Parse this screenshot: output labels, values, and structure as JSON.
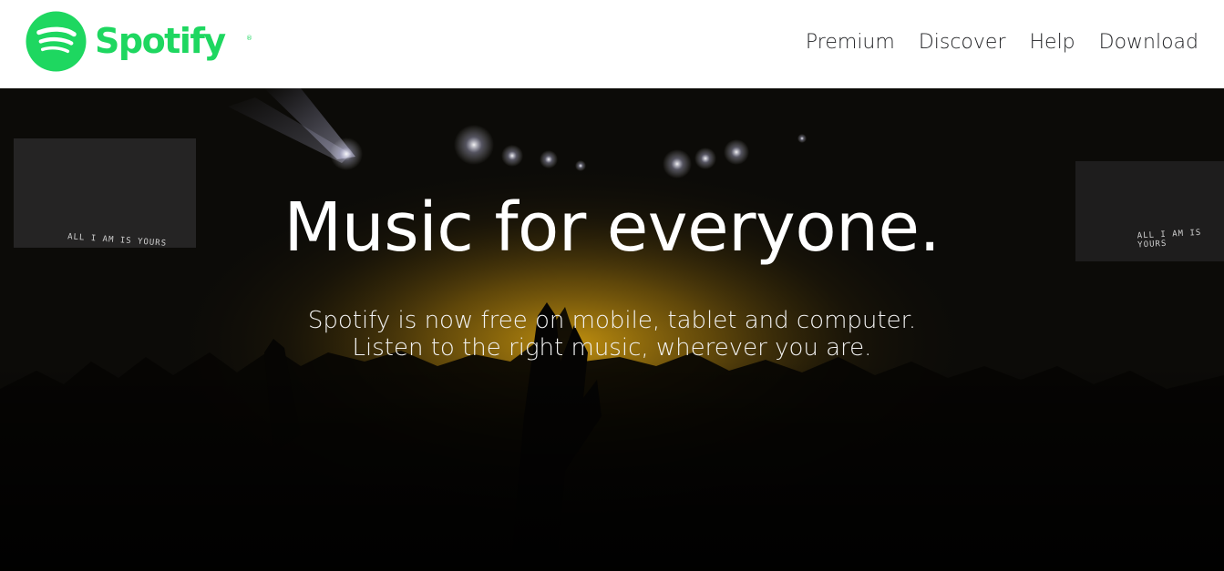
{
  "brand": {
    "name": "Spotify",
    "registered_mark": "®",
    "color": "#1ed760",
    "icon": "spotify-logo-icon"
  },
  "nav": {
    "links": [
      {
        "label": "Premium"
      },
      {
        "label": "Discover"
      },
      {
        "label": "Help"
      },
      {
        "label": "Download"
      }
    ]
  },
  "hero": {
    "title": "Music for everyone.",
    "subtitle_line1": "Spotify is now free on mobile, tablet and computer.",
    "subtitle_line2": "Listen to the right music, wherever you are.",
    "screen_left_text": "ALL I AM IS YOURS",
    "screen_right_text": "ALL I AM IS YOURS",
    "background": "concert-crowd-image"
  },
  "colors": {
    "nav_background": "#ffffff",
    "nav_text": "#222326",
    "hero_glow": "#b88a10"
  }
}
